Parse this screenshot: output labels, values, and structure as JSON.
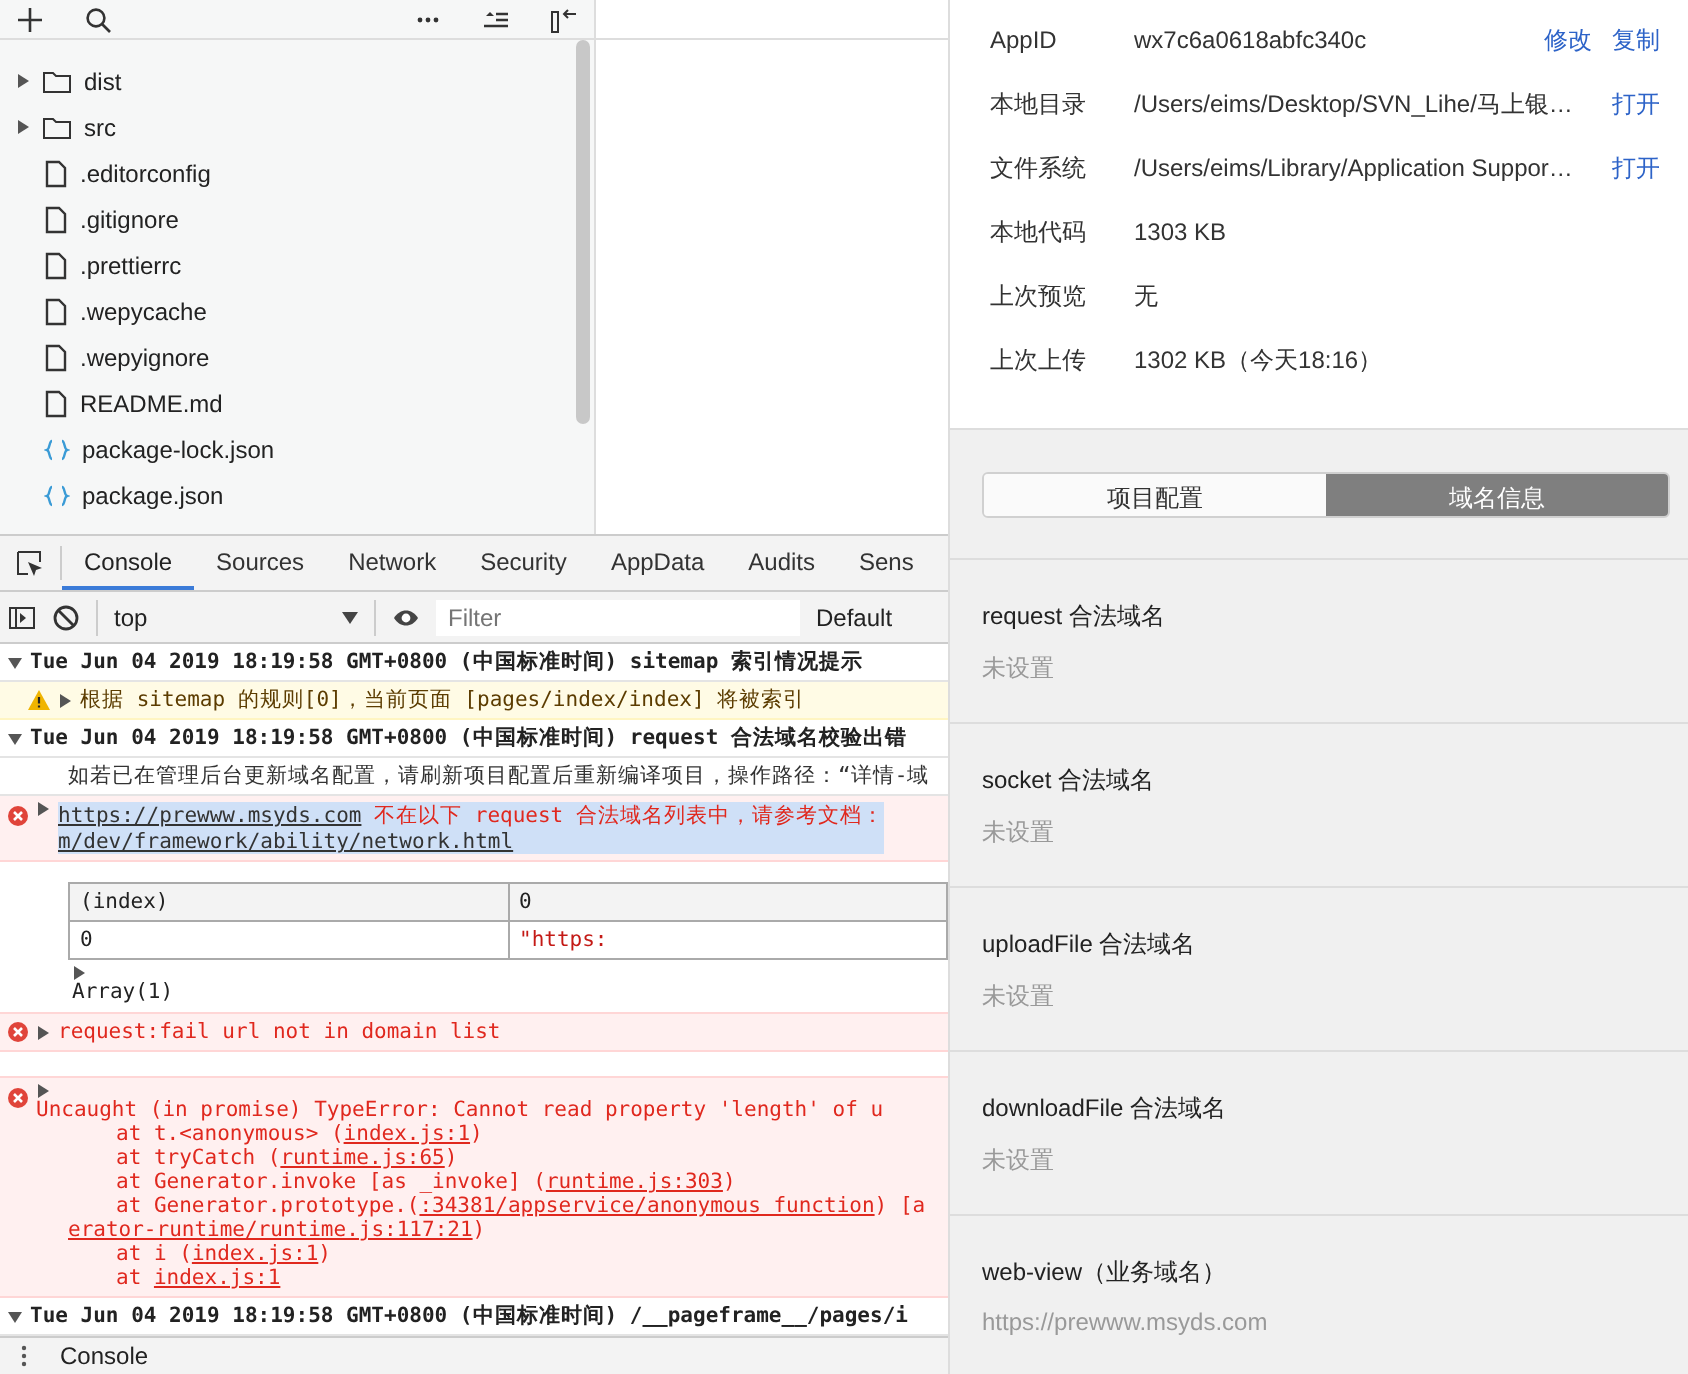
{
  "explorer": {
    "items": [
      {
        "kind": "folder",
        "name": "dist",
        "expanded": false
      },
      {
        "kind": "folder",
        "name": "src",
        "expanded": false
      },
      {
        "kind": "file",
        "name": ".editorconfig"
      },
      {
        "kind": "file",
        "name": ".gitignore"
      },
      {
        "kind": "file",
        "name": ".prettierrc"
      },
      {
        "kind": "file",
        "name": ".wepycache"
      },
      {
        "kind": "file",
        "name": ".wepyignore"
      },
      {
        "kind": "file",
        "name": "README.md"
      },
      {
        "kind": "json",
        "name": "package-lock.json"
      },
      {
        "kind": "json",
        "name": "package.json"
      }
    ]
  },
  "devtools": {
    "tabs": [
      {
        "label": "Console",
        "selected": true
      },
      {
        "label": "Sources",
        "selected": false
      },
      {
        "label": "Network",
        "selected": false
      },
      {
        "label": "Security",
        "selected": false
      },
      {
        "label": "AppData",
        "selected": false
      },
      {
        "label": "Audits",
        "selected": false
      },
      {
        "label": "Sens",
        "selected": false
      }
    ],
    "context": "top",
    "filter": {
      "placeholder": "Filter"
    },
    "levels": "Default",
    "log": [
      {
        "kind": "group",
        "text": "Tue Jun 04 2019 18:19:58 GMT+0800 (中国标准时间) sitemap 索引情况提示",
        "expanded": true
      },
      {
        "kind": "warning",
        "text": "根据 sitemap 的规则[0]，当前页面 [pages/index/index] 将被索引"
      },
      {
        "kind": "group",
        "text": "Tue Jun 04 2019 18:19:58 GMT+0800 (中国标准时间) request 合法域名校验出错",
        "expanded": true
      },
      {
        "kind": "info",
        "text": "如若已在管理后台更新域名配置，请刷新项目配置后重新编译项目，操作路径：“详情-域"
      },
      {
        "kind": "error-link",
        "link": "https://prewww.msyds.com",
        "text": "不在以下 request 合法域名列表中，请参考文档：",
        "continuation": "m/dev/framework/ability/network.html",
        "selected": true
      },
      {
        "kind": "table",
        "columns": [
          "(index)",
          "0"
        ],
        "rows": [
          [
            "0",
            "\"https:"
          ]
        ],
        "footer": "Array(1)"
      },
      {
        "kind": "error",
        "text": "request:fail url not in domain list"
      },
      {
        "kind": "spacer"
      },
      {
        "kind": "error-stack",
        "text": "Uncaught (in promise) TypeError: Cannot read property 'length' of u",
        "stack": [
          {
            "kind": "frame",
            "prefix": "at t.<anonymous> (",
            "link": "index.js:1",
            "suffix": ")"
          },
          {
            "kind": "frame",
            "prefix": "at tryCatch (",
            "link": "runtime.js:65",
            "suffix": ")"
          },
          {
            "kind": "frame",
            "prefix": "at Generator.invoke [as _invoke] (",
            "link": "runtime.js:303",
            "suffix": ")"
          },
          {
            "kind": "frame",
            "prefix": "at Generator.prototype.(",
            "link": ":34381/appservice/anonymous function",
            "suffix": ") [a"
          },
          {
            "kind": "wrap",
            "link": "erator-runtime/runtime.js:117:21",
            "suffix": ")"
          },
          {
            "kind": "frame",
            "prefix": "at i (",
            "link": "index.js:1",
            "suffix": ")"
          },
          {
            "kind": "frame",
            "prefix": "at ",
            "link": "index.js:1"
          }
        ]
      },
      {
        "kind": "group",
        "text": "Tue Jun 04 2019 18:19:58 GMT+0800 (中国标准时间) /__pageframe__/pages/i",
        "expanded": true
      }
    ],
    "drawer": {
      "tab": "Console"
    }
  },
  "details": {
    "rows": [
      {
        "label": "AppID",
        "value": "wx7c6a0618abfc340c",
        "actions": [
          "修改",
          "复制"
        ]
      },
      {
        "label": "本地目录",
        "value": "/Users/eims/Desktop/SVN_Lihe/马上银…",
        "actions": [
          "打开"
        ]
      },
      {
        "label": "文件系统",
        "value": "/Users/eims/Library/Application Suppor…",
        "actions": [
          "打开"
        ]
      },
      {
        "label": "本地代码",
        "value": "1303 KB",
        "actions": []
      },
      {
        "label": "上次预览",
        "value": "无",
        "actions": []
      },
      {
        "label": "上次上传",
        "value": "1302 KB（今天18:16）",
        "actions": []
      }
    ],
    "segments": [
      {
        "label": "项目配置",
        "selected": false
      },
      {
        "label": "域名信息",
        "selected": true
      }
    ],
    "domains": [
      {
        "title": "request 合法域名",
        "value": "未设置"
      },
      {
        "title": "socket 合法域名",
        "value": "未设置"
      },
      {
        "title": "uploadFile 合法域名",
        "value": "未设置"
      },
      {
        "title": "downloadFile 合法域名",
        "value": "未设置"
      },
      {
        "title": "web-view（业务域名）",
        "value": "https://prewww.msyds.com"
      }
    ]
  }
}
